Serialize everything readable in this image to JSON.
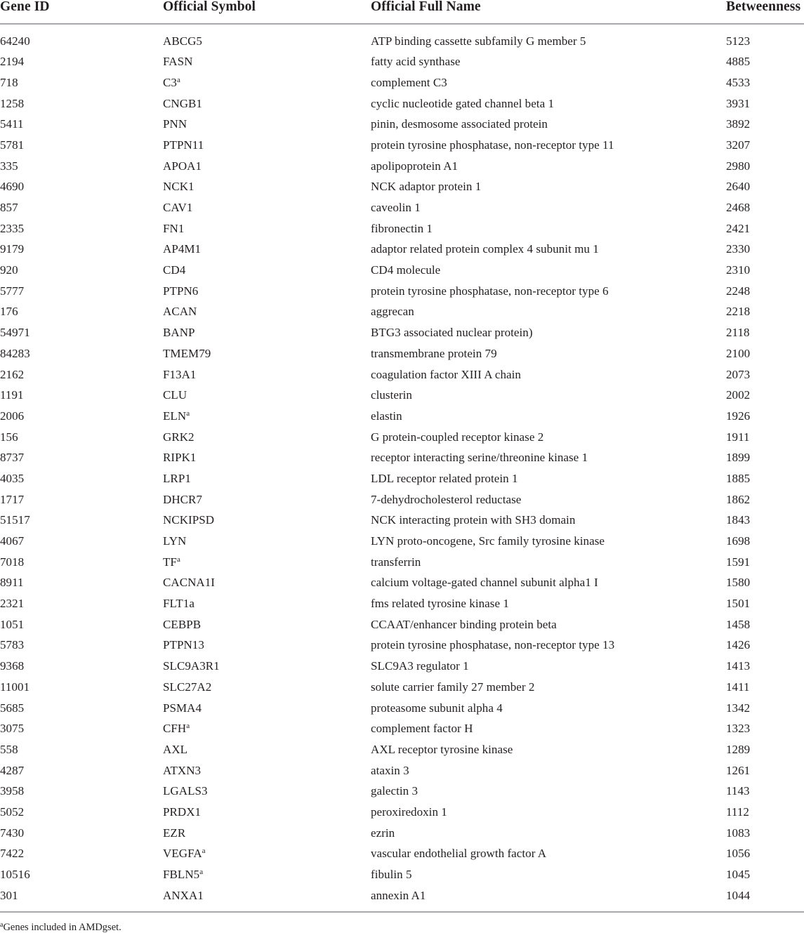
{
  "table": {
    "columns": [
      {
        "key": "gene_id",
        "label": "Gene ID"
      },
      {
        "key": "symbol",
        "label": "Official Symbol"
      },
      {
        "key": "full_name",
        "label": "Official Full Name"
      },
      {
        "key": "betweenness",
        "label": "Betweenness"
      }
    ],
    "rows": [
      {
        "gene_id": "64240",
        "symbol": "ABCG5",
        "symbol_footnote": false,
        "full_name": "ATP binding cassette subfamily G member 5",
        "betweenness": "5123"
      },
      {
        "gene_id": "2194",
        "symbol": "FASN",
        "symbol_footnote": false,
        "full_name": "fatty acid synthase",
        "betweenness": "4885"
      },
      {
        "gene_id": "718",
        "symbol": "C3",
        "symbol_footnote": true,
        "full_name": "complement C3",
        "betweenness": "4533"
      },
      {
        "gene_id": "1258",
        "symbol": "CNGB1",
        "symbol_footnote": false,
        "full_name": "cyclic nucleotide gated channel beta 1",
        "betweenness": "3931"
      },
      {
        "gene_id": "5411",
        "symbol": "PNN",
        "symbol_footnote": false,
        "full_name": "pinin, desmosome associated protein",
        "betweenness": "3892"
      },
      {
        "gene_id": "5781",
        "symbol": "PTPN11",
        "symbol_footnote": false,
        "full_name": "protein tyrosine phosphatase, non-receptor type 11",
        "betweenness": "3207"
      },
      {
        "gene_id": "335",
        "symbol": "APOA1",
        "symbol_footnote": false,
        "full_name": "apolipoprotein A1",
        "betweenness": "2980"
      },
      {
        "gene_id": "4690",
        "symbol": "NCK1",
        "symbol_footnote": false,
        "full_name": "NCK adaptor protein 1",
        "betweenness": "2640"
      },
      {
        "gene_id": "857",
        "symbol": "CAV1",
        "symbol_footnote": false,
        "full_name": "caveolin 1",
        "betweenness": "2468"
      },
      {
        "gene_id": "2335",
        "symbol": "FN1",
        "symbol_footnote": false,
        "full_name": "fibronectin 1",
        "betweenness": "2421"
      },
      {
        "gene_id": "9179",
        "symbol": "AP4M1",
        "symbol_footnote": false,
        "full_name": "adaptor related protein complex 4 subunit mu 1",
        "betweenness": "2330"
      },
      {
        "gene_id": "920",
        "symbol": "CD4",
        "symbol_footnote": false,
        "full_name": "CD4 molecule",
        "betweenness": "2310"
      },
      {
        "gene_id": "5777",
        "symbol": "PTPN6",
        "symbol_footnote": false,
        "full_name": "protein tyrosine phosphatase, non-receptor type 6",
        "betweenness": "2248"
      },
      {
        "gene_id": "176",
        "symbol": "ACAN",
        "symbol_footnote": false,
        "full_name": "aggrecan",
        "betweenness": "2218"
      },
      {
        "gene_id": "54971",
        "symbol": "BANP",
        "symbol_footnote": false,
        "full_name": "BTG3 associated nuclear protein)",
        "betweenness": "2118"
      },
      {
        "gene_id": "84283",
        "symbol": "TMEM79",
        "symbol_footnote": false,
        "full_name": "transmembrane protein 79",
        "betweenness": "2100"
      },
      {
        "gene_id": "2162",
        "symbol": "F13A1",
        "symbol_footnote": false,
        "full_name": "coagulation factor XIII A chain",
        "betweenness": "2073"
      },
      {
        "gene_id": "1191",
        "symbol": "CLU",
        "symbol_footnote": false,
        "full_name": "clusterin",
        "betweenness": "2002"
      },
      {
        "gene_id": "2006",
        "symbol": "ELN",
        "symbol_footnote": true,
        "full_name": "elastin",
        "betweenness": "1926"
      },
      {
        "gene_id": "156",
        "symbol": "GRK2",
        "symbol_footnote": false,
        "full_name": "G protein-coupled receptor kinase 2",
        "betweenness": "1911"
      },
      {
        "gene_id": "8737",
        "symbol": "RIPK1",
        "symbol_footnote": false,
        "full_name": "receptor interacting serine/threonine kinase 1",
        "betweenness": "1899"
      },
      {
        "gene_id": "4035",
        "symbol": "LRP1",
        "symbol_footnote": false,
        "full_name": "LDL receptor related protein 1",
        "betweenness": "1885"
      },
      {
        "gene_id": "1717",
        "symbol": "DHCR7",
        "symbol_footnote": false,
        "full_name": "7-dehydrocholesterol reductase",
        "betweenness": "1862"
      },
      {
        "gene_id": "51517",
        "symbol": "NCKIPSD",
        "symbol_footnote": false,
        "full_name": "NCK interacting protein with SH3 domain",
        "betweenness": "1843"
      },
      {
        "gene_id": "4067",
        "symbol": "LYN",
        "symbol_footnote": false,
        "full_name": "LYN proto-oncogene, Src family tyrosine kinase",
        "betweenness": "1698"
      },
      {
        "gene_id": "7018",
        "symbol": "TF",
        "symbol_footnote": true,
        "full_name": "transferrin",
        "betweenness": "1591"
      },
      {
        "gene_id": "8911",
        "symbol": "CACNA1I",
        "symbol_footnote": false,
        "full_name": "calcium voltage-gated channel subunit alpha1 I",
        "betweenness": "1580"
      },
      {
        "gene_id": "2321",
        "symbol": "FLT1a",
        "symbol_footnote": false,
        "full_name": "fms related tyrosine kinase 1",
        "betweenness": "1501"
      },
      {
        "gene_id": "1051",
        "symbol": "CEBPB",
        "symbol_footnote": false,
        "full_name": "CCAAT/enhancer binding protein beta",
        "betweenness": "1458"
      },
      {
        "gene_id": "5783",
        "symbol": "PTPN13",
        "symbol_footnote": false,
        "full_name": "protein tyrosine phosphatase, non-receptor type 13",
        "betweenness": "1426"
      },
      {
        "gene_id": "9368",
        "symbol": "SLC9A3R1",
        "symbol_footnote": false,
        "full_name": "SLC9A3 regulator 1",
        "betweenness": "1413"
      },
      {
        "gene_id": "11001",
        "symbol": "SLC27A2",
        "symbol_footnote": false,
        "full_name": "solute carrier family 27 member 2",
        "betweenness": "1411"
      },
      {
        "gene_id": "5685",
        "symbol": "PSMA4",
        "symbol_footnote": false,
        "full_name": "proteasome subunit alpha 4",
        "betweenness": "1342"
      },
      {
        "gene_id": "3075",
        "symbol": "CFH",
        "symbol_footnote": true,
        "full_name": "complement factor H",
        "betweenness": "1323"
      },
      {
        "gene_id": "558",
        "symbol": "AXL",
        "symbol_footnote": false,
        "full_name": "AXL receptor tyrosine kinase",
        "betweenness": "1289"
      },
      {
        "gene_id": "4287",
        "symbol": "ATXN3",
        "symbol_footnote": false,
        "full_name": "ataxin 3",
        "betweenness": "1261"
      },
      {
        "gene_id": "3958",
        "symbol": "LGALS3",
        "symbol_footnote": false,
        "full_name": "galectin 3",
        "betweenness": "1143"
      },
      {
        "gene_id": "5052",
        "symbol": "PRDX1",
        "symbol_footnote": false,
        "full_name": "peroxiredoxin 1",
        "betweenness": "1112"
      },
      {
        "gene_id": "7430",
        "symbol": "EZR",
        "symbol_footnote": false,
        "full_name": "ezrin",
        "betweenness": "1083"
      },
      {
        "gene_id": "7422",
        "symbol": "VEGFA",
        "symbol_footnote": true,
        "full_name": "vascular endothelial growth factor A",
        "betweenness": "1056"
      },
      {
        "gene_id": "10516",
        "symbol": "FBLN5",
        "symbol_footnote": true,
        "full_name": "fibulin 5",
        "betweenness": "1045"
      },
      {
        "gene_id": "301",
        "symbol": "ANXA1",
        "symbol_footnote": false,
        "full_name": "annexin A1",
        "betweenness": "1044"
      }
    ],
    "footnote": {
      "marker": "a",
      "text": "Genes included in AMDgset."
    }
  }
}
